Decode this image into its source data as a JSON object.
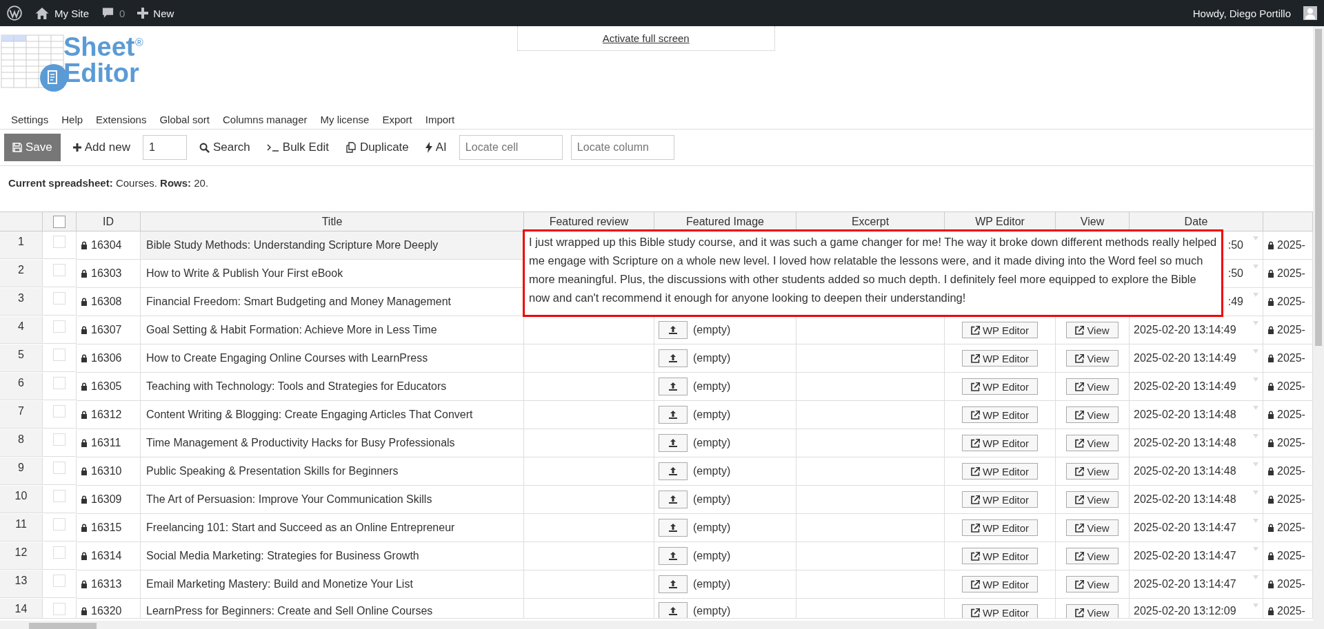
{
  "admin_bar": {
    "site": "My Site",
    "comments": "0",
    "new": "New",
    "greeting": "Howdy, Diego Portillo"
  },
  "fullscreen_link": "Activate full screen",
  "logo": {
    "line1": "Sheet",
    "line2": "Editor",
    "mark": "®"
  },
  "menu": [
    "Settings",
    "Help",
    "Extensions",
    "Global sort",
    "Columns manager",
    "My license",
    "Export",
    "Import"
  ],
  "toolbar": {
    "save": "Save",
    "add_new": "Add new",
    "add_count": "1",
    "search": "Search",
    "bulk_edit": "Bulk Edit",
    "duplicate": "Duplicate",
    "ai": "AI",
    "locate_cell_placeholder": "Locate cell",
    "locate_column_placeholder": "Locate column"
  },
  "summary": "**Current spreadsheet:** Courses. **Rows:** 20.",
  "table": {
    "select_all_checked": false,
    "columns": [
      "ID",
      "Title",
      "Featured review",
      "Featured Image",
      "Excerpt",
      "WP Editor",
      "View",
      "Date"
    ],
    "rows": [
      {
        "number": "1",
        "selected": true,
        "checked": false,
        "id": "16304",
        "title": "Bible Study Methods: Understanding Scripture More Deeply",
        "date": ":50",
        "next_date": "2025-"
      },
      {
        "number": "2",
        "selected": false,
        "checked": false,
        "id": "16303",
        "title": "How to Write & Publish Your First eBook",
        "date": ":50",
        "next_date": "2025-"
      },
      {
        "number": "3",
        "selected": false,
        "checked": false,
        "id": "16308",
        "title": "Financial Freedom: Smart Budgeting and Money Management",
        "date": ":49",
        "next_date": "2025-"
      },
      {
        "number": "4",
        "selected": false,
        "checked": false,
        "id": "16307",
        "title": "Goal Setting & Habit Formation: Achieve More in Less Time",
        "image": "(empty)",
        "wp_editor": "WP Editor",
        "view": "View",
        "date": "2025-02-20 13:14:49",
        "next_date": "2025-"
      },
      {
        "number": "5",
        "selected": false,
        "checked": false,
        "id": "16306",
        "title": "How to Create Engaging Online Courses with LearnPress",
        "image": "(empty)",
        "wp_editor": "WP Editor",
        "view": "View",
        "date": "2025-02-20 13:14:49",
        "next_date": "2025-"
      },
      {
        "number": "6",
        "selected": false,
        "checked": false,
        "id": "16305",
        "title": "Teaching with Technology: Tools and Strategies for Educators",
        "image": "(empty)",
        "wp_editor": "WP Editor",
        "view": "View",
        "date": "2025-02-20 13:14:49",
        "next_date": "2025-"
      },
      {
        "number": "7",
        "selected": false,
        "checked": false,
        "id": "16312",
        "title": "Content Writing & Blogging: Create Engaging Articles That Convert",
        "image": "(empty)",
        "wp_editor": "WP Editor",
        "view": "View",
        "date": "2025-02-20 13:14:48",
        "next_date": "2025-"
      },
      {
        "number": "8",
        "selected": false,
        "checked": false,
        "id": "16311",
        "title": "Time Management & Productivity Hacks for Busy Professionals",
        "image": "(empty)",
        "wp_editor": "WP Editor",
        "view": "View",
        "date": "2025-02-20 13:14:48",
        "next_date": "2025-"
      },
      {
        "number": "9",
        "selected": false,
        "checked": false,
        "id": "16310",
        "title": "Public Speaking & Presentation Skills for Beginners",
        "image": "(empty)",
        "wp_editor": "WP Editor",
        "view": "View",
        "date": "2025-02-20 13:14:48",
        "next_date": "2025-"
      },
      {
        "number": "10",
        "selected": false,
        "checked": false,
        "id": "16309",
        "title": "The Art of Persuasion: Improve Your Communication Skills",
        "image": "(empty)",
        "wp_editor": "WP Editor",
        "view": "View",
        "date": "2025-02-20 13:14:48",
        "next_date": "2025-"
      },
      {
        "number": "11",
        "selected": false,
        "checked": false,
        "id": "16315",
        "title": "Freelancing 101: Start and Succeed as an Online Entrepreneur",
        "image": "(empty)",
        "wp_editor": "WP Editor",
        "view": "View",
        "date": "2025-02-20 13:14:47",
        "next_date": "2025-"
      },
      {
        "number": "12",
        "selected": false,
        "checked": false,
        "id": "16314",
        "title": "Social Media Marketing: Strategies for Business Growth",
        "image": "(empty)",
        "wp_editor": "WP Editor",
        "view": "View",
        "date": "2025-02-20 13:14:47",
        "next_date": "2025-"
      },
      {
        "number": "13",
        "selected": false,
        "checked": false,
        "id": "16313",
        "title": "Email Marketing Mastery: Build and Monetize Your List",
        "image": "(empty)",
        "wp_editor": "WP Editor",
        "view": "View",
        "date": "2025-02-20 13:14:47",
        "next_date": "2025-"
      },
      {
        "number": "14",
        "selected": false,
        "checked": false,
        "id": "16320",
        "title": "LearnPress for Beginners: Create and Sell Online Courses",
        "image": "(empty)",
        "wp_editor": "WP Editor",
        "view": "View",
        "date": "2025-02-20 13:12:09",
        "next_date": "2025-"
      }
    ]
  },
  "cell_editor": {
    "text": "I just wrapped up this Bible study course, and it was such a game changer for me! The way it broke down different methods really helped me engage with Scripture on a whole new level. I loved how relatable the lessons were, and it made diving into the Word feel so much more meaningful. Plus, the discussions with other students added so much depth. I definitely feel more equipped to explore the Bible now and can't recommend it enough for anyone looking to deepen their understanding!"
  }
}
